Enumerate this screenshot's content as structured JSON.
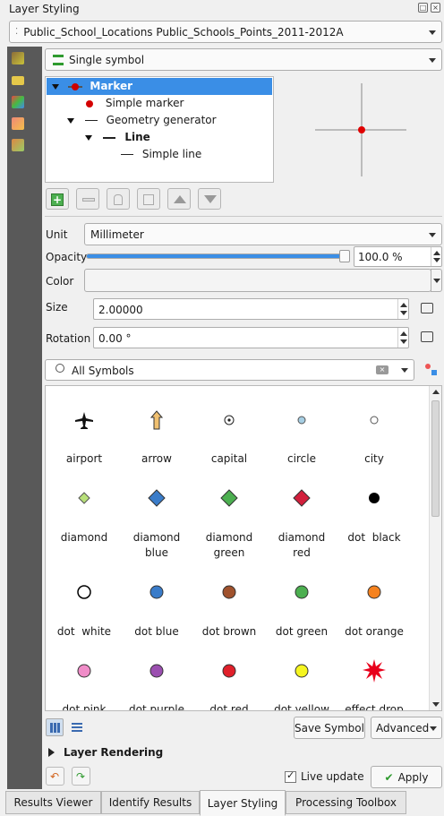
{
  "window": {
    "title": "Layer Styling"
  },
  "layer_combo": {
    "value": "Public_School_Locations Public_Schools_Points_2011-2012A"
  },
  "renderer_combo": {
    "value": "Single symbol"
  },
  "symbol_tree": {
    "items": [
      {
        "label": "Marker",
        "level": 0,
        "selected": true
      },
      {
        "label": "Simple marker",
        "level": 1
      },
      {
        "label": "Geometry generator",
        "level": 1
      },
      {
        "label": "Line",
        "level": 2,
        "bold": true
      },
      {
        "label": "Simple line",
        "level": 3
      }
    ]
  },
  "unit": {
    "label": "Unit",
    "value": "Millimeter"
  },
  "opacity": {
    "label": "Opacity",
    "value": "100.0 %",
    "fraction": 1.0
  },
  "color": {
    "label": "Color"
  },
  "size": {
    "label": "Size",
    "value": "2.00000"
  },
  "rotation": {
    "label": "Rotation",
    "value": "0.00 °"
  },
  "search": {
    "value": "All Symbols"
  },
  "symbols": [
    {
      "name": "airport",
      "icon": "airplane-icon"
    },
    {
      "name": "arrow",
      "icon": "arrow-up-icon"
    },
    {
      "name": "capital",
      "icon": "capital-icon"
    },
    {
      "name": "circle",
      "icon": "circle-icon"
    },
    {
      "name": "city",
      "icon": "city-icon"
    },
    {
      "name": "diamond",
      "icon": "diamond-icon"
    },
    {
      "name": "diamond\nblue",
      "icon": "diamond-blue-icon"
    },
    {
      "name": "diamond\ngreen",
      "icon": "diamond-green-icon"
    },
    {
      "name": "diamond\nred",
      "icon": "diamond-red-icon"
    },
    {
      "name": "dot  black",
      "icon": "dot-black-icon"
    },
    {
      "name": "dot  white",
      "icon": "dot-white-icon"
    },
    {
      "name": "dot blue",
      "icon": "dot-blue-icon"
    },
    {
      "name": "dot brown",
      "icon": "dot-brown-icon"
    },
    {
      "name": "dot green",
      "icon": "dot-green-icon"
    },
    {
      "name": "dot orange",
      "icon": "dot-orange-icon"
    },
    {
      "name": "dot pink",
      "icon": "dot-pink-icon"
    },
    {
      "name": "dot purple",
      "icon": "dot-purple-icon"
    },
    {
      "name": "dot red",
      "icon": "dot-red-icon"
    },
    {
      "name": "dot yellow",
      "icon": "dot-yellow-icon"
    },
    {
      "name": "effect drop",
      "icon": "effect-drop-icon"
    }
  ],
  "buttons": {
    "save_symbol": "Save Symbol",
    "advanced": "Advanced",
    "apply": "Apply"
  },
  "layer_rendering": {
    "label": "Layer Rendering"
  },
  "live_update": {
    "label": "Live update",
    "checked": true
  },
  "tabs": [
    {
      "label": "Results Viewer"
    },
    {
      "label": "Identify Results"
    },
    {
      "label": "Layer Styling",
      "active": true
    },
    {
      "label": "Processing Toolbox"
    }
  ],
  "colors": {
    "selection": "#3a8ee6",
    "accent_green": "#2e9a2e"
  }
}
